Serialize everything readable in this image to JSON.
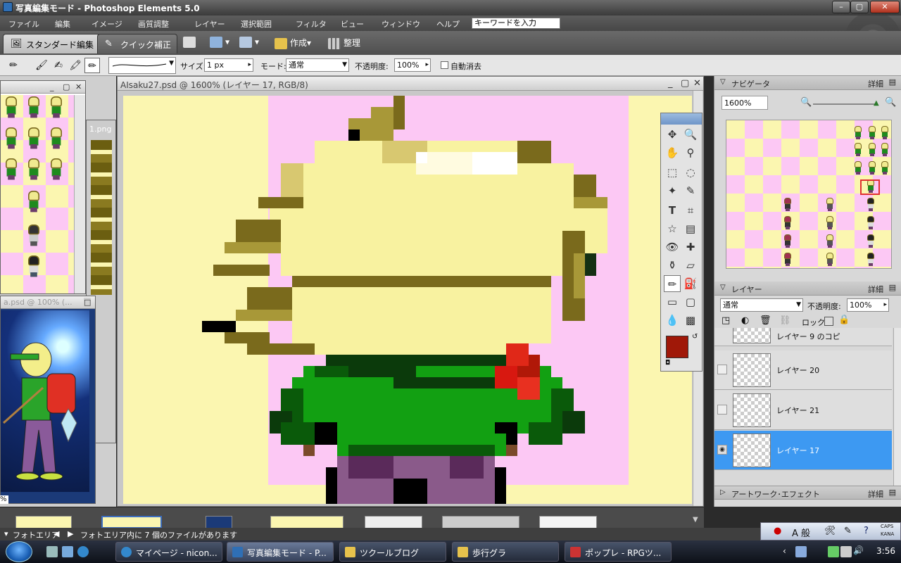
{
  "window": {
    "title": "写真編集モード - Photoshop Elements 5.0"
  },
  "menu": {
    "items": [
      "ファイル",
      "編集",
      "イメージ",
      "画質調整",
      "レイヤー",
      "選択範囲",
      "フィルタ",
      "ビュー",
      "ウィンドウ",
      "ヘルプ"
    ],
    "search_placeholder": "キーワードを入力"
  },
  "shortcuts": {
    "tab_standard": "スタンダード編集",
    "tab_quick": "クイック補正",
    "create": "作成",
    "organize": "整理"
  },
  "options": {
    "size_label": "サイズ:",
    "size_value": "1 px",
    "mode_label": "モード:",
    "mode_value": "通常",
    "opacity_label": "不透明度:",
    "opacity_value": "100%",
    "auto_erase_label": "自動消去"
  },
  "left_windows": {
    "doc2_title": "1.png",
    "doc3_title": "a.psd @ 100% (..."
  },
  "canvas": {
    "title": "AIsaku27.psd @ 1600% (レイヤー 17, RGB/8)",
    "colors": {
      "bg_yellow": "#fbf6b0",
      "bg_pink": "#fcc8f4"
    }
  },
  "navigator": {
    "title": "ナビゲータ",
    "more": "詳細",
    "zoom": "1600%"
  },
  "layers": {
    "title": "レイヤー",
    "more": "詳細",
    "blend_mode": "通常",
    "opacity_label": "不透明度:",
    "opacity_value": "100%",
    "lock_label": "ロック:",
    "rows": [
      {
        "name": "レイヤー 9 のコピ"
      },
      {
        "name": "レイヤー 20"
      },
      {
        "name": "レイヤー 21"
      },
      {
        "name": "レイヤー 17"
      }
    ]
  },
  "artwork": {
    "title": "アートワーク･エフェクト",
    "more": "詳細"
  },
  "photobin": {
    "label": "フォトエリア",
    "status": "フォトエリア内に 7 個のファイルがあります"
  },
  "taskbar": {
    "buttons": [
      "マイページ - nicon...",
      "写真編集モード - P...",
      "ツクールブログ",
      "歩行グラ",
      "ポップレ - RPGツ..."
    ],
    "clock": "3:56"
  },
  "ime": {
    "label": "A 般",
    "caps": "CAPS",
    "kana": "KANA"
  }
}
